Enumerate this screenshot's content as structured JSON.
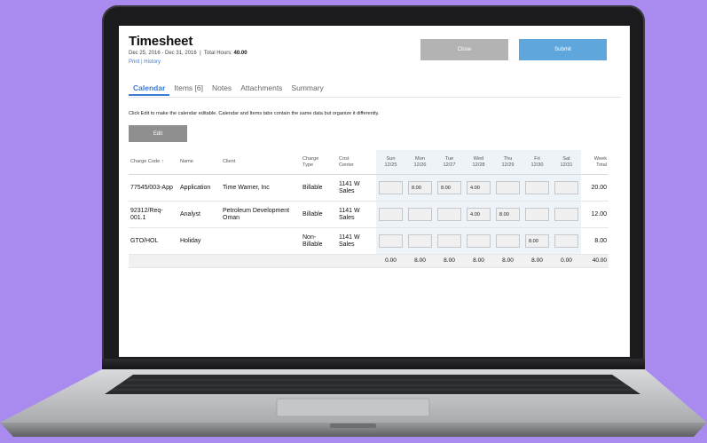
{
  "header": {
    "title": "Timesheet",
    "period": "Dec 25, 2016 - Dec 31, 2016",
    "separator": "|",
    "total_label": "Total Hours:",
    "total_value": "40.00",
    "print_link": "Print",
    "link_sep": "|",
    "history_link": "History",
    "close_label": "Close",
    "submit_label": "Submit"
  },
  "tabs": [
    {
      "label": "Calendar",
      "active": true
    },
    {
      "label": "Items [6]"
    },
    {
      "label": "Notes"
    },
    {
      "label": "Attachments"
    },
    {
      "label": "Summary"
    }
  ],
  "hint": "Click Edit to make the calendar editable. Calendar and Items tabs contain the same data but organize it differently.",
  "edit_label": "Edit",
  "columns": {
    "charge_code": "Charge Code",
    "sort_icon": "↑",
    "name": "Name",
    "client": "Client",
    "charge_type_1": "Charge",
    "charge_type_2": "Type",
    "cost_center_1": "Cost",
    "cost_center_2": "Center",
    "days": [
      {
        "day": "Sun",
        "date": "12/25"
      },
      {
        "day": "Mon",
        "date": "12/26"
      },
      {
        "day": "Tue",
        "date": "12/27"
      },
      {
        "day": "Wed",
        "date": "12/28"
      },
      {
        "day": "Thu",
        "date": "12/29"
      },
      {
        "day": "Fri",
        "date": "12/30"
      },
      {
        "day": "Sat",
        "date": "12/31"
      }
    ],
    "week_1": "Week",
    "week_2": "Total"
  },
  "rows": [
    {
      "code": "77545/003-App",
      "name": "Application",
      "client": "Time Warner, Inc",
      "type": "Billable",
      "cost": "1141 W Sales",
      "hours": [
        "",
        "8.00",
        "8.00",
        "4.00",
        "",
        "",
        ""
      ],
      "total": "20.00"
    },
    {
      "code": "92312/Req-001.1",
      "name": "Analyst",
      "client": "Petroleum Development Oman",
      "type": "Billable",
      "cost": "1141 W Sales",
      "hours": [
        "",
        "",
        "",
        "4.00",
        "8.00",
        "",
        ""
      ],
      "total": "12.00"
    },
    {
      "code": "GTO/HOL",
      "name": "Holiday",
      "client": "",
      "type": "Non-Billable",
      "cost": "1141 W Sales",
      "hours": [
        "",
        "",
        "",
        "",
        "",
        "8.00",
        ""
      ],
      "total": "8.00"
    }
  ],
  "totals": [
    "0.00",
    "8.00",
    "8.00",
    "8.00",
    "8.00",
    "8.00",
    "0.00"
  ],
  "grand_total": "40.00",
  "colors": {
    "background": "#a98bf0",
    "accent": "#3a7bd5",
    "submit": "#5ea6dc",
    "close": "#b3b3b3",
    "edit": "#8f8f8f"
  }
}
